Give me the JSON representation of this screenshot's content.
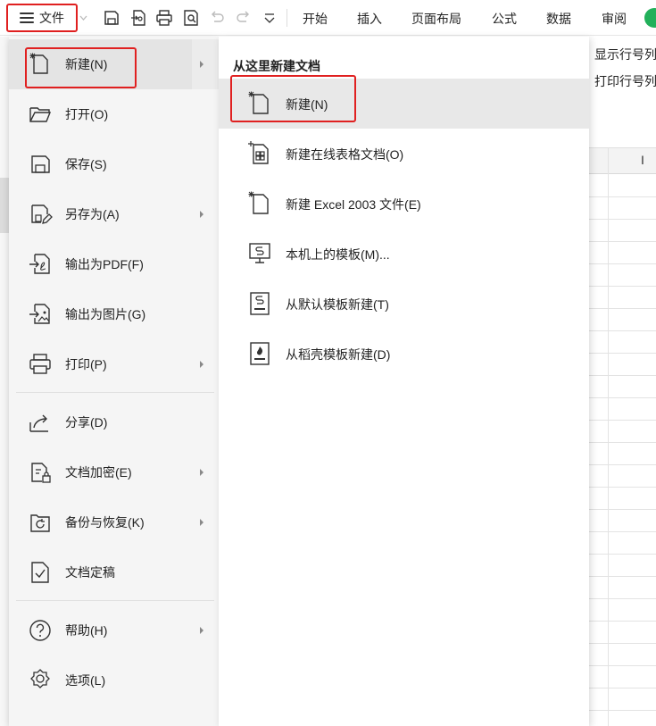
{
  "toolbar": {
    "file_label": "文件",
    "tabs": [
      "开始",
      "插入",
      "页面布局",
      "公式",
      "数据",
      "审阅"
    ]
  },
  "sheet": {
    "side_lines": [
      "显示行号列",
      "打印行号列"
    ],
    "column_letter": "I"
  },
  "menu": {
    "items": [
      {
        "label": "新建(N)",
        "icon": "new-doc-icon",
        "has_submenu": true
      },
      {
        "label": "打开(O)",
        "icon": "folder-open-icon",
        "has_submenu": false
      },
      {
        "label": "保存(S)",
        "icon": "save-icon",
        "has_submenu": false
      },
      {
        "label": "另存为(A)",
        "icon": "save-as-icon",
        "has_submenu": true
      },
      {
        "label": "输出为PDF(F)",
        "icon": "export-pdf-icon",
        "has_submenu": false
      },
      {
        "label": "输出为图片(G)",
        "icon": "export-image-icon",
        "has_submenu": false
      },
      {
        "label": "打印(P)",
        "icon": "printer-icon",
        "has_submenu": true
      },
      {
        "label": "分享(D)",
        "icon": "share-icon",
        "has_submenu": false
      },
      {
        "label": "文档加密(E)",
        "icon": "encrypt-doc-icon",
        "has_submenu": true
      },
      {
        "label": "备份与恢复(K)",
        "icon": "backup-restore-icon",
        "has_submenu": true
      },
      {
        "label": "文档定稿",
        "icon": "finalize-doc-icon",
        "has_submenu": false
      },
      {
        "label": "帮助(H)",
        "icon": "help-icon",
        "has_submenu": true
      },
      {
        "label": "选项(L)",
        "icon": "gear-icon",
        "has_submenu": false
      }
    ]
  },
  "submenu": {
    "title": "从这里新建文档",
    "items": [
      {
        "label": "新建(N)",
        "icon": "new-doc-icon"
      },
      {
        "label": "新建在线表格文档(O)",
        "icon": "online-sheet-icon"
      },
      {
        "label": "新建 Excel 2003 文件(E)",
        "icon": "excel-2003-icon"
      },
      {
        "label": "本机上的模板(M)...",
        "icon": "local-template-icon"
      },
      {
        "label": "从默认模板新建(T)",
        "icon": "default-template-icon"
      },
      {
        "label": "从稻壳模板新建(D)",
        "icon": "docer-template-icon"
      }
    ]
  },
  "colors": {
    "highlight_border": "#e02020",
    "avatar": "#22b05a"
  }
}
